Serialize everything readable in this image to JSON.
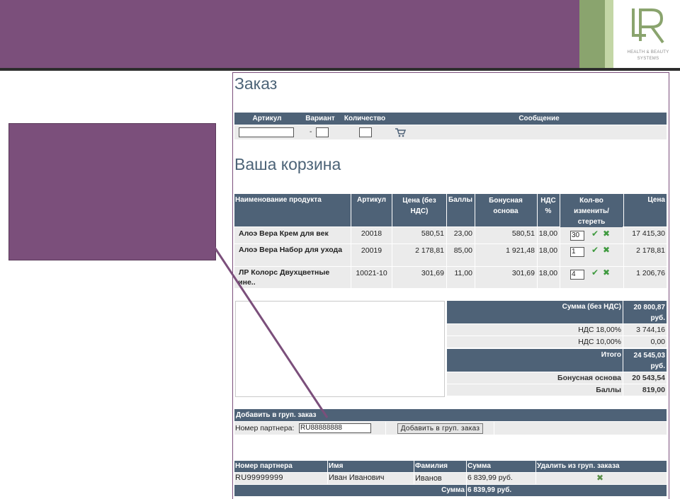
{
  "brand": {
    "logo_letters": "LR",
    "tagline_line1": "HEALTH & BEAUTY",
    "tagline_line2": "SYSTEMS",
    "colors": {
      "purple": "#7b4f7b",
      "green": "#8aa46e",
      "light_green": "#c3d6a6",
      "header_blue": "#4e6277"
    }
  },
  "order": {
    "title": "Заказ",
    "columns": [
      "Артикул",
      "Вариант",
      "Количество",
      "",
      "Сообщение"
    ],
    "article_value": "",
    "variant_dash": "-",
    "variant_value": "",
    "quantity_value": "",
    "cart_icon": "cart-icon"
  },
  "cart": {
    "title": "Ваша корзина",
    "columns": {
      "name": "Наименование продукта",
      "article": "Артикул",
      "price_net_1": "Цена (без",
      "price_net_2": "НДС)",
      "points": "Баллы",
      "bonus_1": "Бонусная",
      "bonus_2": "основа",
      "vat_1": "НДС",
      "vat_2": "%",
      "qty_1": "Кол-во",
      "qty_2": "изменить/",
      "qty_3": "стереть",
      "price": "Цена"
    },
    "rows": [
      {
        "name_1": "Алоэ Вера Крем для век",
        "name_2": "",
        "article": "20018",
        "price_net": "580,51",
        "points": "23,00",
        "bonus": "580,51",
        "vat": "18,00",
        "qty": "30",
        "total": "17 415,30"
      },
      {
        "name_1": "Алоэ Вера Набор для ухода",
        "name_2": "..",
        "article": "20019",
        "price_net": "2 178,81",
        "points": "85,00",
        "bonus": "1 921,48",
        "vat": "18,00",
        "qty": "1",
        "total": "2 178,81"
      },
      {
        "name_1": "ЛР Колорс Двухцветные",
        "name_2": "тине..",
        "article": "10021-10",
        "price_net": "301,69",
        "points": "11,00",
        "bonus": "301,69",
        "vat": "18,00",
        "qty": "4",
        "total": "1 206,76"
      }
    ]
  },
  "summary": {
    "sum_net_label": "Сумма (без НДС)",
    "sum_net_value_1": "20 800,87",
    "sum_net_value_2": "руб.",
    "vat18_label": "НДС 18,00%",
    "vat18_value": "3 744,16",
    "vat10_label": "НДС 10,00%",
    "vat10_value": "0,00",
    "total_label": "Итого",
    "total_value_1": "24 545,03",
    "total_value_2": "руб.",
    "bonus_label": "Бонусная основа",
    "bonus_value": "20 543,54",
    "points_label": "Баллы",
    "points_value": "819,00"
  },
  "group_order": {
    "header": "Добавить в груп. заказ",
    "partner_label": "Номер партнера:",
    "partner_value": "RU88888888",
    "add_button": "Добавить в груп. заказ"
  },
  "partners": {
    "columns": [
      "Номер партнера",
      "Имя",
      "Фамилия",
      "Сумма",
      "Удалить из груп. заказа"
    ],
    "rows": [
      {
        "number": "RU99999999",
        "first_name": "Иван Иванович",
        "last_name": "Иванов",
        "sum": "6 839,99 руб."
      }
    ],
    "total_label": "Сумма",
    "total_value": "6 839,99 руб."
  }
}
